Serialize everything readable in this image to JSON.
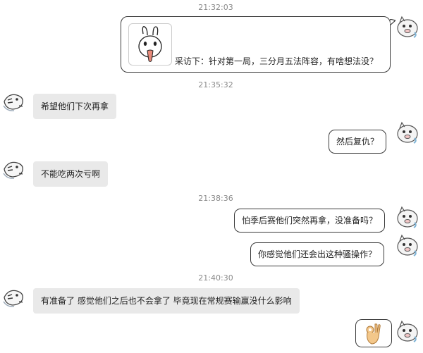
{
  "timestamps": [
    "21:32:03",
    "21:35:32",
    "21:38:36",
    "21:40:30"
  ],
  "messages": {
    "m1": "采访下：针对第一局，三分月五法阵容，有啥想法没？",
    "m2": "希望他们下次再拿",
    "m3": "然后复仇？",
    "m4": "不能吃两次亏啊",
    "m5": "怕季后赛他们突然再拿，没准备吗？",
    "m6": "你感觉他们还会出这种骚操作？",
    "m7": "有准备了 感觉他们之后也不会拿了 毕竟现在常规赛输赢没什么影响"
  },
  "colors": {
    "incoming_bubble": "#e9e9e9",
    "outgoing_bubble": "#ffffff",
    "outgoing_border": "#3b3b3b",
    "timestamp": "#8a8a8a"
  },
  "icons": {
    "self_avatar": "sketch-pig-avatar-icon",
    "other_avatar": "sketch-frog-avatar-icon",
    "bunny_sticker": "bunny-sticker-icon",
    "ok_hand_sticker": "ok-hand-sticker-icon"
  }
}
